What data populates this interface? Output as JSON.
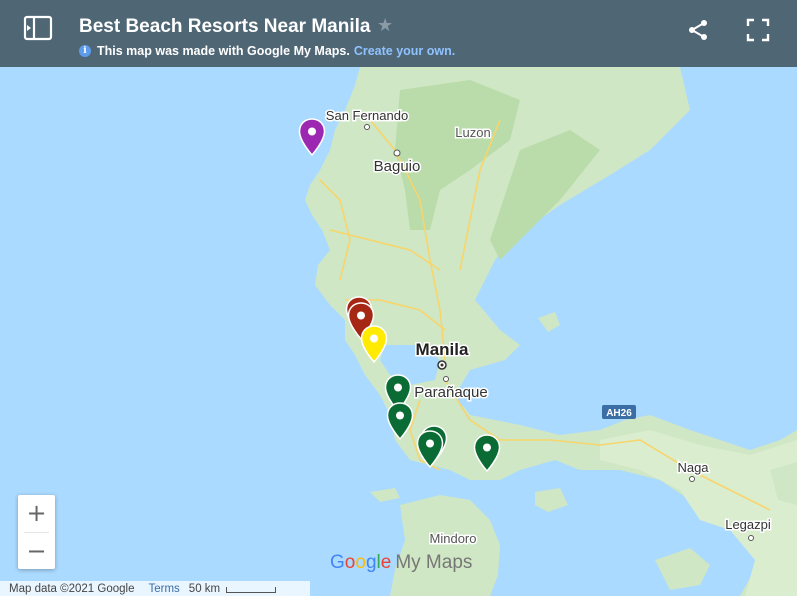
{
  "header": {
    "title": "Best Beach Resorts Near Manila",
    "info_text": "This map was made with Google My Maps.",
    "info_link": "Create your own."
  },
  "map": {
    "labels": {
      "san_fernando": "San Fernando",
      "luzon": "Luzon",
      "baguio": "Baguio",
      "manila": "Manila",
      "paranaque": "Parañaque",
      "ah26": "AH26",
      "naga": "Naga",
      "legazpi": "Legazpi",
      "mindoro": "Mindoro"
    },
    "pins": [
      {
        "name": "purple-pin",
        "color": "#9c27b0"
      },
      {
        "name": "red-pin-1",
        "color": "#a52714"
      },
      {
        "name": "red-pin-2",
        "color": "#a52714"
      },
      {
        "name": "yellow-pin",
        "color": "#ffea00"
      },
      {
        "name": "green-pin-1",
        "color": "#0b6b34"
      },
      {
        "name": "green-pin-2",
        "color": "#0b6b34"
      },
      {
        "name": "green-pin-3",
        "color": "#0b6b34"
      },
      {
        "name": "green-pin-4",
        "color": "#0b6b34"
      },
      {
        "name": "green-pin-5",
        "color": "#0b6b34"
      }
    ]
  },
  "controls": {
    "zoom_in": "+",
    "zoom_out": "−"
  },
  "attribution": {
    "map_data": "Map data ©2021 Google",
    "terms": "Terms",
    "scale": "50 km"
  },
  "watermark": {
    "my_maps": "My Maps"
  }
}
